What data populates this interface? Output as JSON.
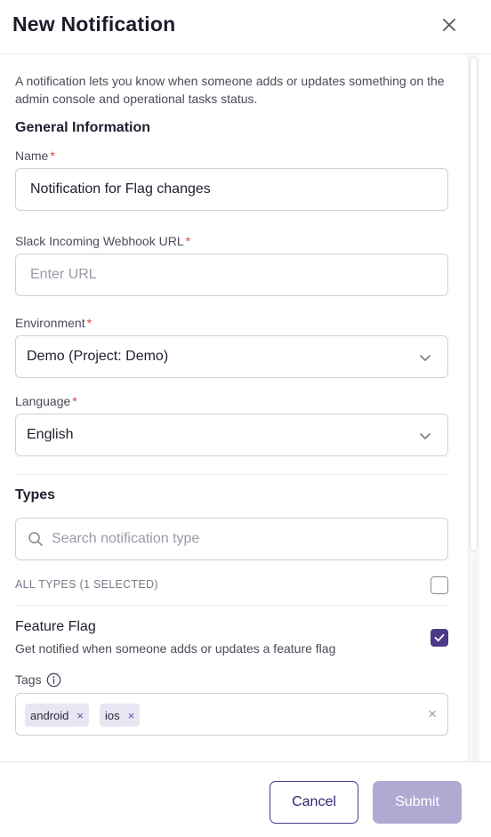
{
  "dialog": {
    "title": "New Notification",
    "description": "A notification lets you know when someone adds or updates something on the admin console and operational tasks status."
  },
  "general": {
    "section_title": "General Information",
    "name": {
      "label": "Name",
      "required": "*",
      "value": "Notification for Flag changes"
    },
    "webhook": {
      "label": "Slack Incoming Webhook URL",
      "required": "*",
      "value": "",
      "placeholder": "Enter URL"
    },
    "environment": {
      "label": "Environment",
      "required": "*",
      "selected": "Demo (Project: Demo)"
    },
    "language": {
      "label": "Language",
      "required": "*",
      "selected": "English"
    }
  },
  "types": {
    "section_title": "Types",
    "search_placeholder": "Search notification type",
    "all_types_label": "ALL TYPES (1 SELECTED)",
    "all_types_checked": false,
    "items": [
      {
        "title": "Feature Flag",
        "description": "Get notified when someone adds or updates a feature flag",
        "checked": true,
        "tags_label": "Tags",
        "tags": [
          "android",
          "ios"
        ],
        "tag_remove_glyph": "×",
        "clear_glyph": "×"
      }
    ]
  },
  "footer": {
    "cancel_label": "Cancel",
    "submit_label": "Submit"
  },
  "colors": {
    "accent": "#4b3a8a",
    "submit_disabled": "#b2a9d3",
    "required": "#e0453f",
    "tag_bg": "#e8e6f3"
  },
  "icons": [
    "close-icon",
    "chevron-down-icon",
    "search-icon",
    "checkmark-icon",
    "info-icon",
    "tag-remove-icon",
    "clear-icon"
  ]
}
